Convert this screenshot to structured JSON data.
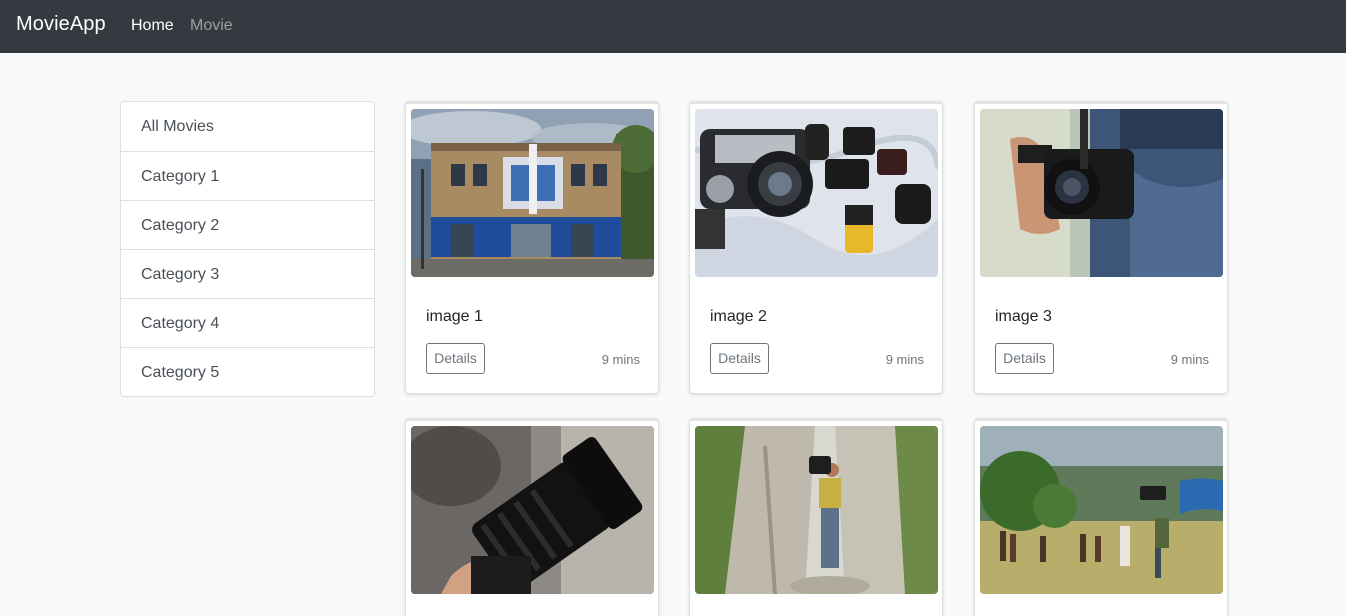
{
  "navbar": {
    "brand": "MovieApp",
    "links": [
      "Home",
      "Movie"
    ]
  },
  "sidebar": {
    "items": [
      "All Movies",
      "Category 1",
      "Category 2",
      "Category 3",
      "Category 4",
      "Category 5"
    ]
  },
  "cards": [
    {
      "title": "image 1",
      "button": "Details",
      "duration": "9 mins"
    },
    {
      "title": "image 2",
      "button": "Details",
      "duration": "9 mins"
    },
    {
      "title": "image 3",
      "button": "Details",
      "duration": "9 mins"
    },
    {
      "title": "",
      "button": "",
      "duration": ""
    },
    {
      "title": "",
      "button": "",
      "duration": ""
    },
    {
      "title": "",
      "button": "",
      "duration": ""
    }
  ]
}
